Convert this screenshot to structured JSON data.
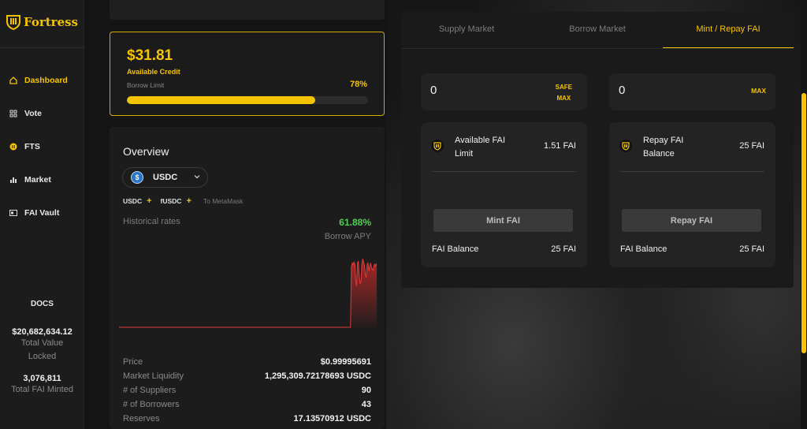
{
  "brand": {
    "name": "Fortress",
    "color": "#f5c400"
  },
  "sidebar": {
    "items": [
      {
        "label": "Dashboard",
        "icon": "home-icon",
        "active": true
      },
      {
        "label": "Vote",
        "icon": "grid-icon",
        "active": false
      },
      {
        "label": "FTS",
        "icon": "coin-icon",
        "active": false
      },
      {
        "label": "Market",
        "icon": "bar-chart-icon",
        "active": false
      },
      {
        "label": "FAI Vault",
        "icon": "vault-icon",
        "active": false
      }
    ],
    "docs": "DOCS",
    "tvl_value": "$20,682,634.12",
    "tvl_label_1": "Total Value",
    "tvl_label_2": "Locked",
    "fai_minted_value": "3,076,811",
    "fai_minted_label": "Total FAI Minted"
  },
  "credit": {
    "amount": "$31.81",
    "label": "Available Credit",
    "borrow_limit_label": "Borrow Limit",
    "borrow_limit_pct": "78%",
    "borrow_limit_fraction": 0.78
  },
  "overview": {
    "title": "Overview",
    "asset": "USDC",
    "asset_icon": "usdc-coin-icon",
    "token_a": "USDC",
    "token_b": "fUSDC",
    "add_symbol": "+",
    "metamask": "To MetaMask",
    "historical_label": "Historical rates",
    "apy_value": "61.88%",
    "apy_label": "Borrow APY",
    "rows": [
      {
        "k": "Price",
        "v": "$0.99995691"
      },
      {
        "k": "Market Liquidity",
        "v": "1,295,309.72178693 USDC"
      },
      {
        "k": "# of Suppliers",
        "v": "90"
      },
      {
        "k": "# of Borrowers",
        "v": "43"
      },
      {
        "k": "Reserves",
        "v": "17.13570912 USDC"
      }
    ]
  },
  "chart_data": {
    "type": "line",
    "title": "",
    "series": [
      {
        "values": [
          0,
          0,
          0,
          0,
          0,
          0,
          0,
          0,
          0,
          0,
          0,
          0,
          0,
          0,
          0,
          0,
          0,
          0,
          0,
          0,
          0,
          0,
          0,
          0,
          0,
          0,
          0,
          0,
          0,
          0,
          0,
          0,
          0,
          0,
          0,
          0,
          0,
          0,
          0,
          0,
          0,
          0,
          0,
          0,
          0,
          0,
          0,
          0,
          0,
          0,
          0,
          0,
          0,
          0,
          0,
          0,
          0,
          0,
          0,
          0,
          0,
          0,
          0,
          0,
          0,
          0,
          0,
          0,
          0,
          0,
          0,
          0,
          0,
          0,
          0,
          0,
          0,
          0,
          0,
          0,
          0,
          0,
          0,
          0,
          0,
          0,
          0,
          0,
          0,
          0,
          0,
          0,
          0,
          0,
          0,
          0,
          0,
          0,
          0,
          0,
          0,
          0,
          0,
          0,
          0,
          0,
          0,
          0,
          0,
          0,
          0,
          0,
          0,
          0,
          0,
          0,
          0,
          0,
          0,
          0,
          0,
          0,
          0,
          0,
          0,
          0,
          0,
          0,
          0,
          0,
          0,
          0,
          0,
          0,
          0,
          0,
          0,
          0,
          0,
          0,
          0,
          0,
          0,
          0,
          0,
          0,
          0,
          0,
          0,
          0,
          0,
          0,
          0,
          0,
          0,
          0,
          0,
          0,
          0,
          0,
          0,
          0,
          0,
          0,
          0,
          0,
          0,
          0,
          0,
          0,
          0,
          0,
          0,
          0,
          0,
          0,
          0,
          0,
          0,
          0,
          0,
          0,
          0,
          0,
          0,
          0,
          0,
          0,
          0,
          0,
          0,
          0,
          0,
          0,
          0,
          0,
          0,
          0,
          0,
          0,
          0,
          0,
          0,
          0,
          0,
          0,
          0,
          0,
          0,
          0,
          0,
          0,
          0,
          0,
          0,
          0,
          0,
          0,
          0,
          0,
          0,
          0,
          0,
          0,
          0,
          0,
          0,
          0,
          0,
          0,
          0,
          0,
          0,
          0,
          0,
          0,
          0,
          0,
          0,
          0,
          0,
          0,
          0,
          0,
          0,
          0,
          0,
          0,
          0,
          0,
          0,
          0,
          0,
          0,
          0,
          0,
          0,
          0,
          0,
          0,
          0,
          0,
          0,
          0,
          0,
          0,
          58,
          62,
          60,
          63,
          61,
          45,
          40,
          62,
          64,
          50,
          42,
          44,
          62,
          66,
          63,
          60,
          51,
          48,
          61,
          62,
          54,
          59,
          62,
          58,
          56,
          55,
          60,
          61,
          59,
          62
        ]
      }
    ],
    "color": "#e03a3a"
  },
  "fai": {
    "tabs": [
      {
        "label": "Supply Market",
        "active": false
      },
      {
        "label": "Borrow Market",
        "active": false
      },
      {
        "label": "Mint / Repay FAI",
        "active": true
      }
    ],
    "mint": {
      "input_value": "0",
      "safe_label": "SAFE",
      "max_label": "MAX",
      "title_1": "Available FAI",
      "title_2": "Limit",
      "value": "1.51 FAI",
      "button": "Mint FAI",
      "balance_label": "FAI Balance",
      "balance_value": "25 FAI"
    },
    "repay": {
      "input_value": "0",
      "max_label": "MAX",
      "title_1": "Repay FAI",
      "title_2": "Balance",
      "value": "25 FAI",
      "button": "Repay FAI",
      "balance_label": "FAI Balance",
      "balance_value": "25 FAI"
    }
  }
}
